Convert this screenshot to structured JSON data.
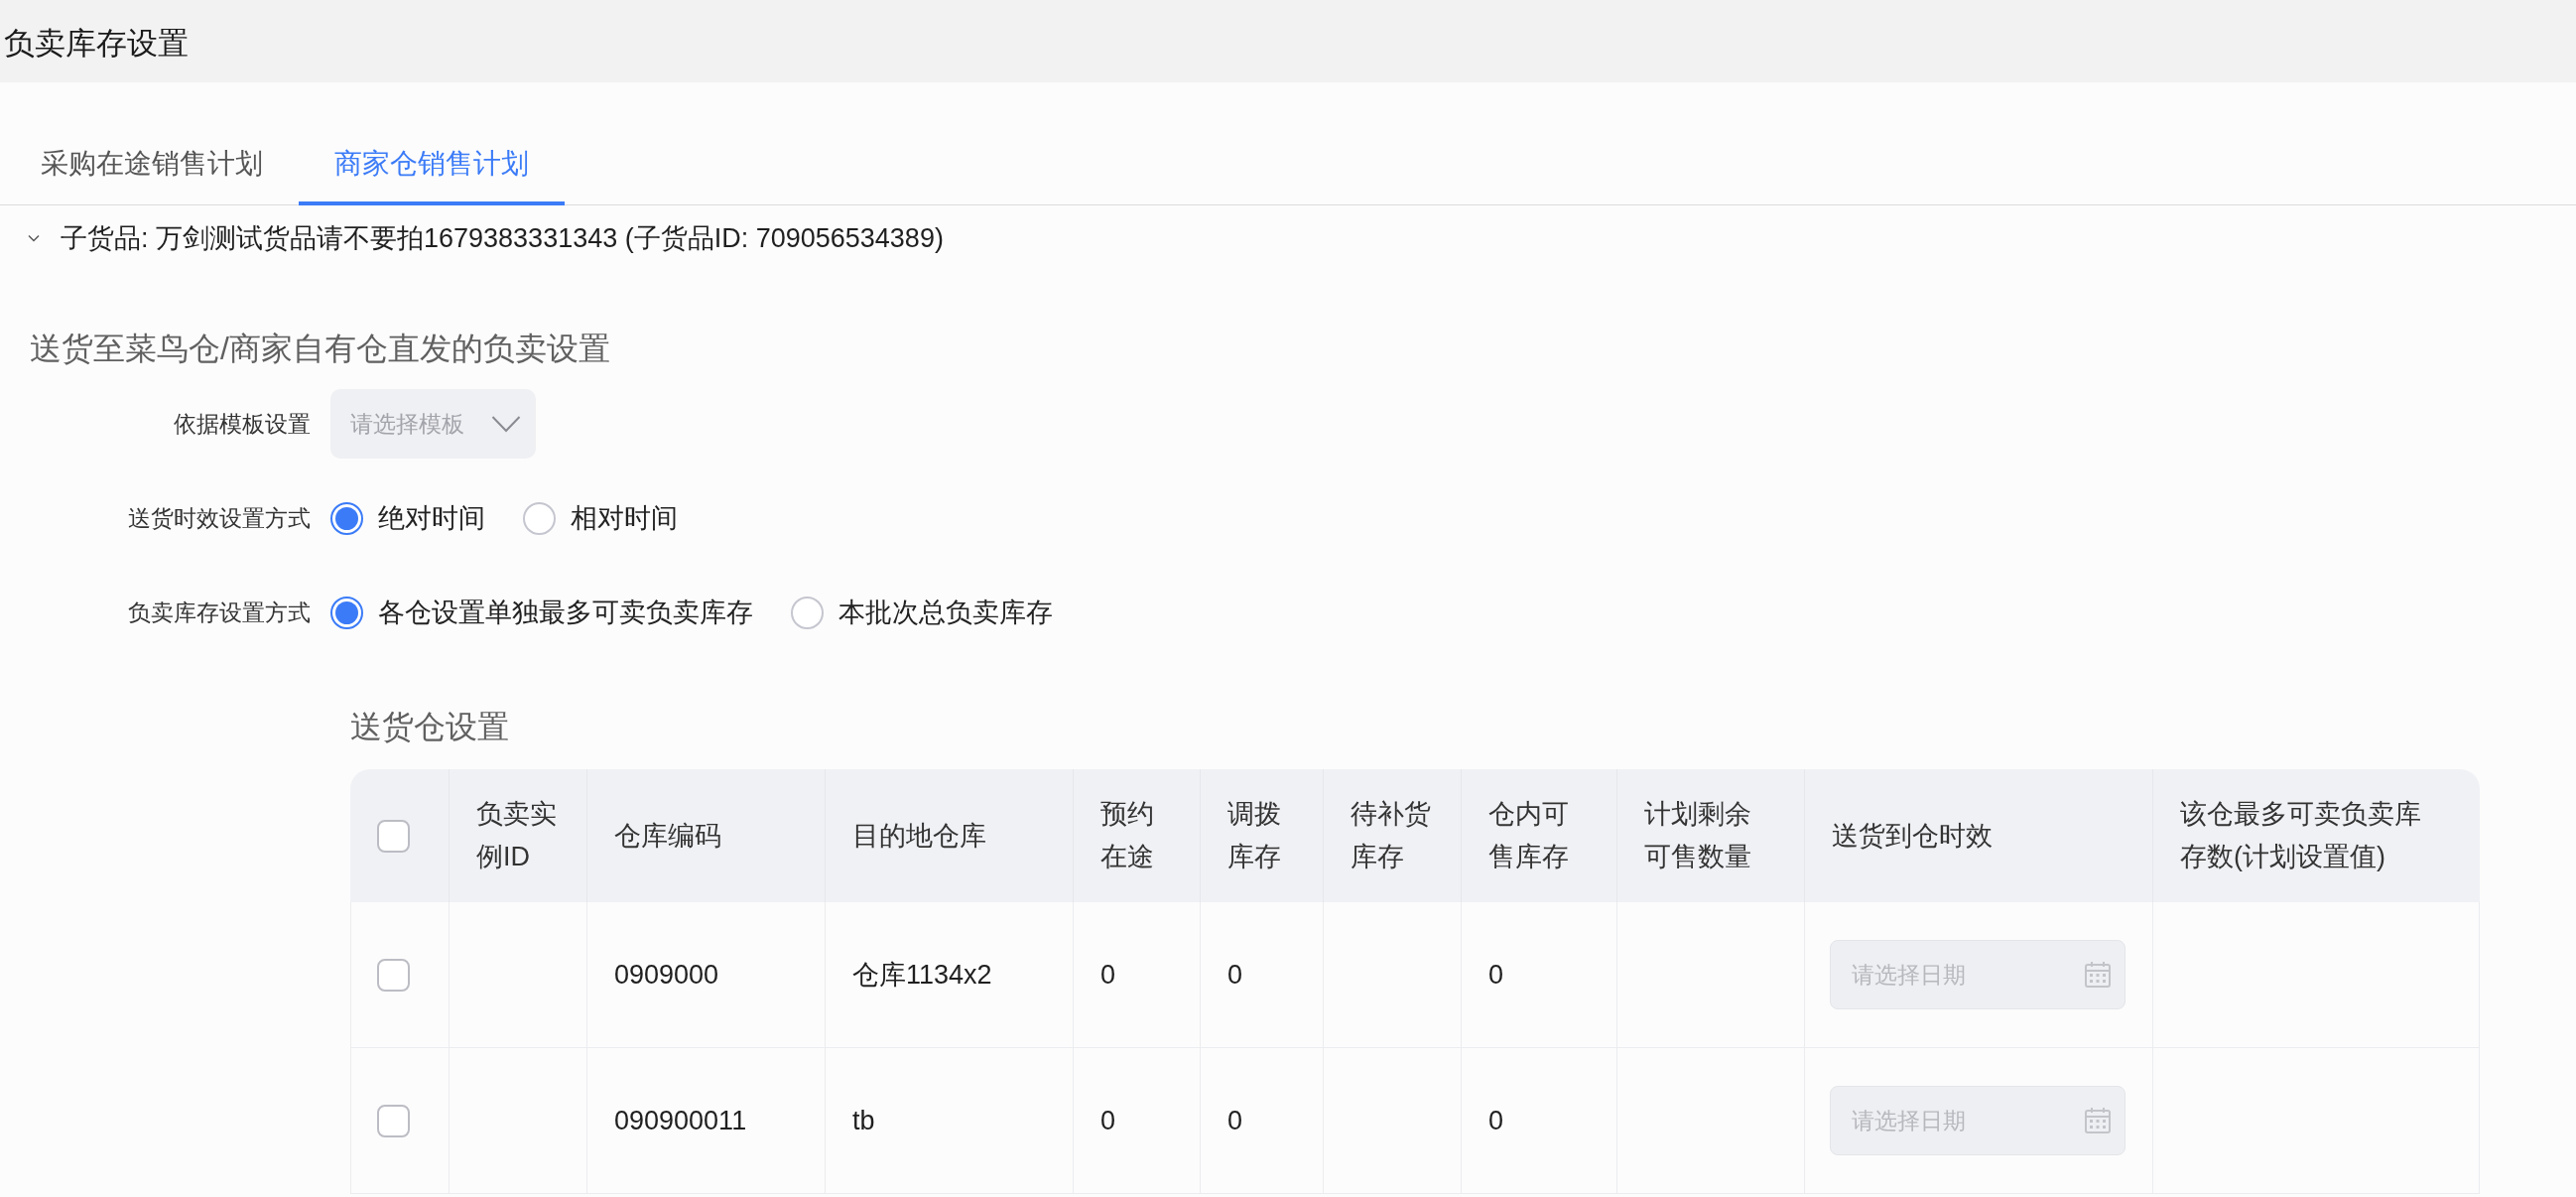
{
  "header": {
    "title": "负卖库存设置"
  },
  "tabs": [
    {
      "label": "采购在途销售计划",
      "selected": false
    },
    {
      "label": "商家仓销售计划",
      "selected": true
    }
  ],
  "sub_item": {
    "expanded": true,
    "title": "子货品: 万剑测试货品请不要拍1679383331343 (子货品ID: 709056534389)"
  },
  "delivery_settings": {
    "title": "送货至菜鸟仓/商家自有仓直发的负卖设置",
    "fields": [
      {
        "kind": "select",
        "label": "依据模板设置",
        "placeholder": "请选择模板"
      },
      {
        "kind": "radio",
        "label": "送货时效设置方式",
        "options": [
          {
            "label": "绝对时间",
            "selected": true
          },
          {
            "label": "相对时间",
            "selected": false
          }
        ]
      },
      {
        "kind": "radio",
        "label": "负卖库存设置方式",
        "options": [
          {
            "label": "各仓设置单独最多可卖负卖库存",
            "selected": true
          },
          {
            "label": "本批次总负卖库存",
            "selected": false
          }
        ]
      }
    ]
  },
  "warehouse_table": {
    "title": "送货仓设置",
    "select_all": {
      "checked": false
    },
    "columns": [
      "负卖实例ID",
      "仓库编码",
      "目的地仓库",
      "预约在途",
      "调拨库存",
      "待补货库存",
      "仓内可售库存",
      "计划剩余可售数量",
      "送货到仓时效",
      "该仓最多可卖负卖库存数(计划设置值)"
    ],
    "rows": [
      {
        "checked": false,
        "warehouse_code": "0909000",
        "destination_warehouse": "仓库1134x2",
        "reserved_in_transit": "0",
        "transfer_stock": "0",
        "in_warehouse_sellable": "0",
        "delivery_time": {
          "placeholder": "请选择日期"
        }
      },
      {
        "checked": false,
        "warehouse_code": "090900011",
        "destination_warehouse": "tb",
        "reserved_in_transit": "0",
        "transfer_stock": "0",
        "in_warehouse_sellable": "0",
        "delivery_time": {
          "placeholder": "请选择日期"
        }
      }
    ]
  }
}
